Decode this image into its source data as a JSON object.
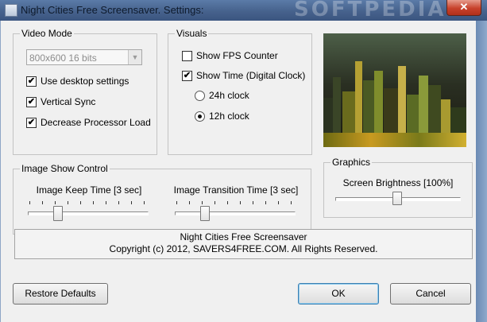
{
  "window": {
    "title": "Night Cities Free Screensaver. Settings:",
    "watermark": "SOFTPEDIA",
    "close_glyph": "✕"
  },
  "video_mode": {
    "legend": "Video Mode",
    "resolution": "800x600 16 bits",
    "use_desktop": {
      "label": "Use desktop settings",
      "checked": true
    },
    "vsync": {
      "label": "Vertical Sync",
      "checked": true
    },
    "processor": {
      "label": "Decrease Processor Load",
      "checked": true
    }
  },
  "visuals": {
    "legend": "Visuals",
    "fps": {
      "label": "Show FPS Counter",
      "checked": false
    },
    "show_time": {
      "label": "Show Time (Digital Clock)",
      "checked": true
    },
    "clock24": {
      "label": "24h clock",
      "selected": false
    },
    "clock12": {
      "label": "12h clock",
      "selected": true
    }
  },
  "image_show": {
    "legend": "Image Show Control",
    "keep_time": {
      "label": "Image Keep Time [3 sec]",
      "value_fraction": 0.25
    },
    "transition_time": {
      "label": "Image Transition Time [3 sec]",
      "value_fraction": 0.25
    }
  },
  "graphics": {
    "legend": "Graphics",
    "brightness": {
      "label": "Screen Brightness [100%]",
      "value_fraction": 1.0
    }
  },
  "footer": {
    "line1": "Night Cities Free Screensaver",
    "line2": "Copyright (c) 2012, SAVERS4FREE.COM. All Rights Reserved."
  },
  "buttons": {
    "restore": "Restore Defaults",
    "ok": "OK",
    "cancel": "Cancel"
  },
  "icons": {
    "check": "✔",
    "dropdown": "▼"
  },
  "colors": {
    "titlebar": "#46628c",
    "close": "#c7412b",
    "dialog_bg": "#f0f0f0"
  }
}
